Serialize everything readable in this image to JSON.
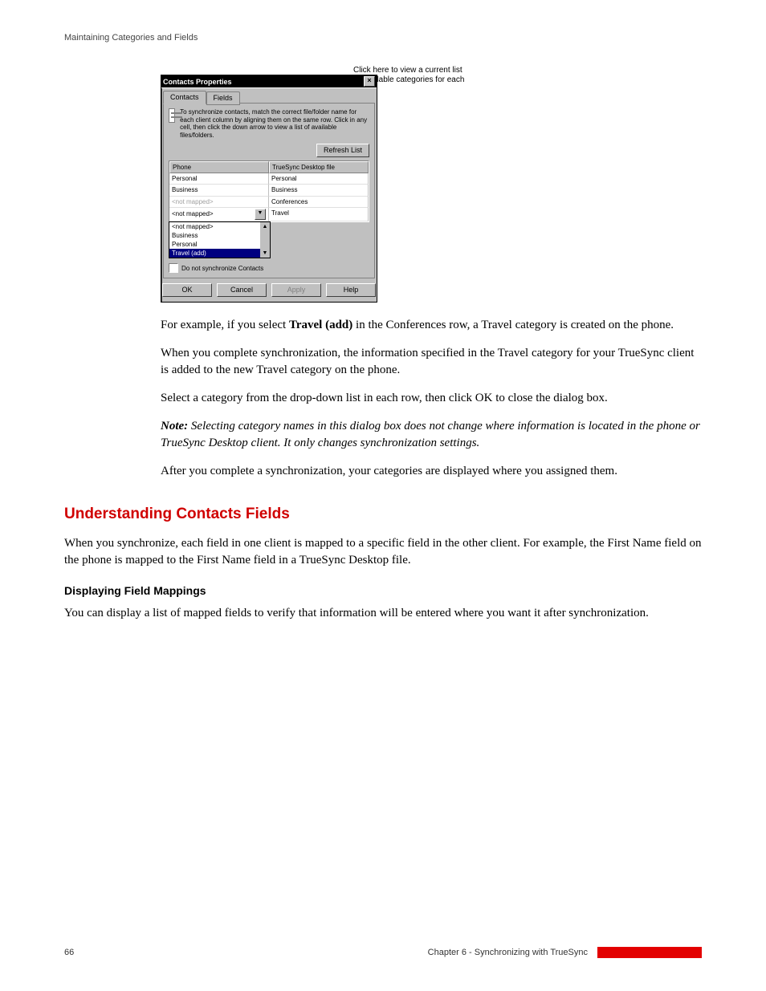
{
  "header": {
    "text": "Maintaining Categories and Fields"
  },
  "callouts": {
    "top": "Click here to view a current list\nof available categories for each\nclient."
  },
  "dialog": {
    "title": "Contacts Properties",
    "close_glyph": "×",
    "tabs": {
      "contacts": "Contacts",
      "fields": "Fields"
    },
    "info": "To synchronize contacts, match the correct file/folder name for each client column by aligning them on the same row. Click in any cell, then click the down arrow to view a list of available files/folders.",
    "refresh": "Refresh List",
    "columns": {
      "phone": "Phone",
      "file": "TrueSync Desktop file"
    },
    "rows": [
      {
        "phone": "Personal",
        "file": "Personal"
      },
      {
        "phone": "Business",
        "file": "Business"
      },
      {
        "phone": "<not mapped>",
        "file": "Conferences",
        "phone_dim": true
      },
      {
        "phone": "<not mapped>",
        "file": "Travel",
        "dropdown": true
      }
    ],
    "dropdown_options": [
      "<not mapped>",
      "Business",
      "Personal",
      "Travel  (add)"
    ],
    "dropdown_selected": "Travel  (add)",
    "do_not_sync": "Do not synchronize Contacts",
    "buttons": {
      "ok": "OK",
      "cancel": "Cancel",
      "apply": "Apply",
      "help": "Help"
    }
  },
  "para": {
    "p1a": "For example, if you select ",
    "p1b": " in the Conferences row, a Travel category is created on the phone.",
    "p1_travel": "Travel (add)",
    "p2": "When you complete synchronization, the information specified in the Travel category for your TrueSync client is added to the new Travel category on the phone.",
    "p3": "Select a category from the drop-down list in each row, then click OK to close the dialog box.",
    "p3_note_label": "Note: ",
    "p3_note": "Selecting category names in this dialog box does not change where information is located in the phone or TrueSync Desktop client. It only changes synchronization settings.",
    "p4": "After you complete a synchronization, your categories are displayed where you assigned them."
  },
  "h1": "Understanding Contacts Fields",
  "fields": {
    "p1": "When you synchronize, each field in one client is mapped to a specific field in the other client. For example, the First Name field on the phone is mapped to the First Name field in a TrueSync Desktop file.",
    "h2": "Displaying Field Mappings",
    "p2": "You can display a list of mapped fields to verify that information will be entered where you want it after synchronization."
  },
  "footer": {
    "page": "66",
    "title": "Chapter 6  - Synchronizing with TrueSync"
  }
}
